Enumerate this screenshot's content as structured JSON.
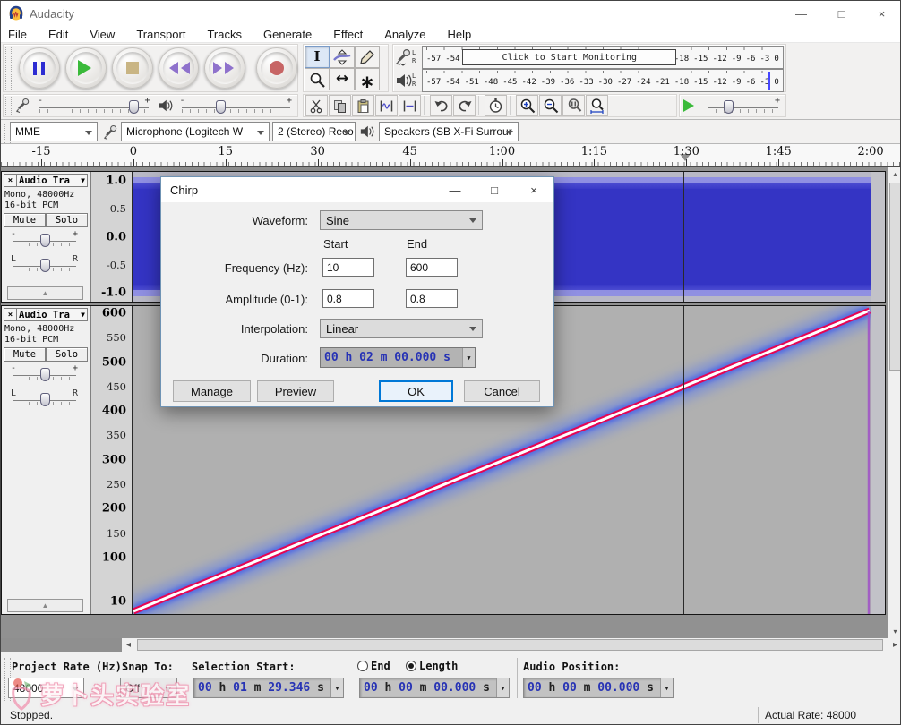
{
  "window": {
    "title": "Audacity"
  },
  "menu": [
    "File",
    "Edit",
    "View",
    "Transport",
    "Tracks",
    "Generate",
    "Effect",
    "Analyze",
    "Help"
  ],
  "transport_icons": [
    "pause-icon",
    "play-icon",
    "stop-icon",
    "skip-to-start-icon",
    "skip-to-end-icon",
    "record-icon"
  ],
  "tool_icons": [
    "selection-tool-icon",
    "envelope-tool-icon",
    "draw-tool-icon",
    "zoom-tool-icon",
    "time-shift-tool-icon",
    "multi-tool-icon"
  ],
  "meters": {
    "scale": [
      "-57",
      "-54",
      "-51",
      "-48",
      "-45",
      "-42",
      "-39",
      "-36",
      "-33",
      "-30",
      "-27",
      "-24",
      "-21",
      "-18",
      "-15",
      "-12",
      "-9",
      "-6",
      "-3",
      "0"
    ],
    "record_overlay": "Click to Start Monitoring",
    "channel_left": "L",
    "channel_right": "R"
  },
  "mixer": {
    "minus": "-",
    "plus": "+"
  },
  "device": {
    "host": "MME",
    "input": "Microphone (Logitech W",
    "channels": "2 (Stereo) Reco",
    "output": "Speakers (SB X-Fi Surrour"
  },
  "timeline": {
    "labels": [
      "-15",
      "0",
      "15",
      "30",
      "45",
      "1:00",
      "1:15",
      "1:30",
      "1:45",
      "2:00"
    ]
  },
  "tracks": [
    {
      "close": "×",
      "name": "Audio Tra",
      "dropdown": "▼",
      "info1": "Mono, 48000Hz",
      "info2": "16-bit PCM",
      "mute": "Mute",
      "solo": "Solo",
      "gain_min": "-",
      "gain_max": "+",
      "pan_left": "L",
      "pan_right": "R",
      "collapse": "▲",
      "ruler": [
        "1.0",
        "0.5",
        "0.0",
        "-0.5",
        "-1.0"
      ]
    },
    {
      "close": "×",
      "name": "Audio Tra",
      "dropdown": "▼",
      "info1": "Mono, 48000Hz",
      "info2": "16-bit PCM",
      "mute": "Mute",
      "solo": "Solo",
      "gain_min": "-",
      "gain_max": "+",
      "pan_left": "L",
      "pan_right": "R",
      "collapse": "▲",
      "ruler": [
        600,
        550,
        500,
        450,
        400,
        350,
        300,
        250,
        200,
        150,
        100,
        10
      ]
    }
  ],
  "dialog": {
    "title": "Chirp",
    "waveform_label": "Waveform:",
    "waveform_value": "Sine",
    "start_header": "Start",
    "end_header": "End",
    "frequency_label": "Frequency (Hz):",
    "frequency_start": "10",
    "frequency_end": "600",
    "amplitude_label": "Amplitude (0-1):",
    "amplitude_start": "0.8",
    "amplitude_end": "0.8",
    "interpolation_label": "Interpolation:",
    "interpolation_value": "Linear",
    "duration_label": "Duration:",
    "duration_value": "00 h 02 m 00.000 s",
    "manage": "Manage",
    "preview": "Preview",
    "ok": "OK",
    "cancel": "Cancel"
  },
  "selection_bar": {
    "project_rate_label": "Project Rate (Hz):",
    "project_rate": "48000",
    "snap_label": "Snap To:",
    "snap": "Off",
    "sel_start_label": "Selection Start:",
    "sel_start": "00 h 01 m 29.346 s",
    "end_label": "End",
    "length_label": "Length",
    "length": "00 h 00 m 00.000 s",
    "audio_pos_label": "Audio Position:",
    "audio_pos": "00 h 00 m 00.000 s"
  },
  "status": {
    "left": "Stopped.",
    "right": "Actual Rate: 48000"
  },
  "watermark": "萝卜头实验室"
}
